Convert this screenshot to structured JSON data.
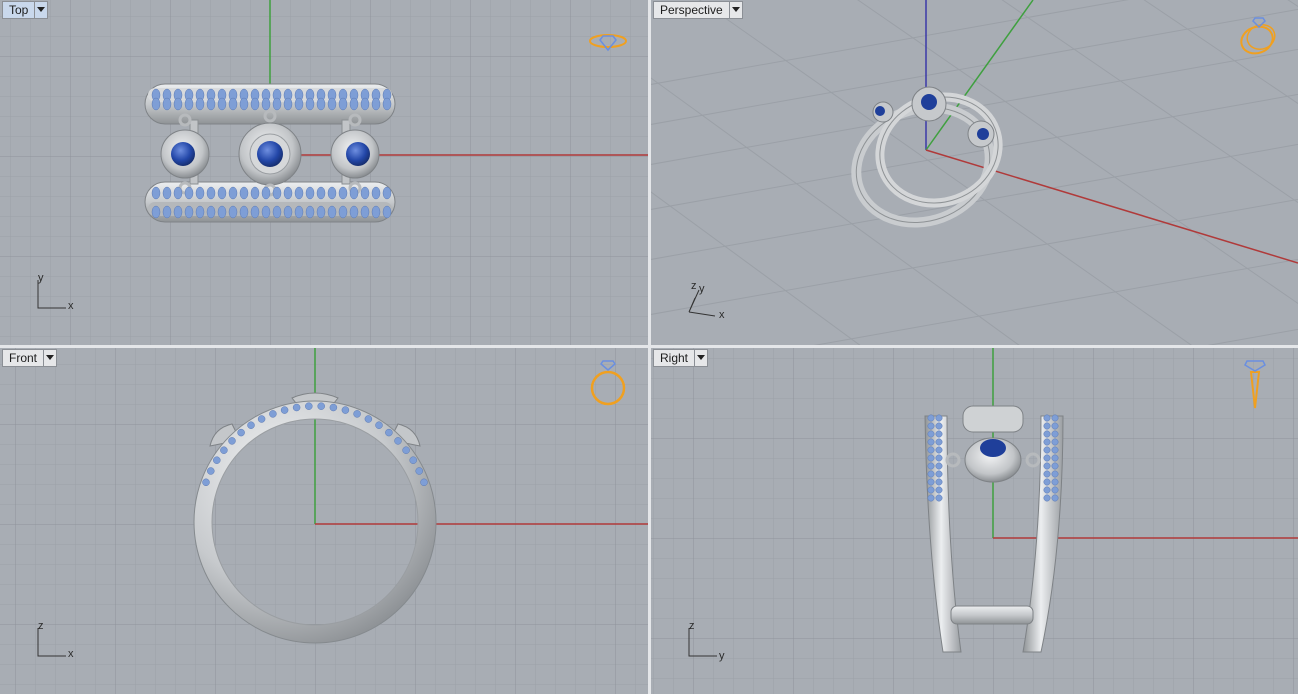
{
  "viewports": {
    "top": {
      "title": "Top",
      "axis_v": "y",
      "axis_h": "x"
    },
    "perspective": {
      "title": "Perspective",
      "axis_z": "z",
      "axis_y": "y",
      "axis_x": "x"
    },
    "front": {
      "title": "Front",
      "axis_v": "z",
      "axis_h": "x"
    },
    "right": {
      "title": "Right",
      "axis_v": "z",
      "axis_h": "y"
    }
  },
  "colors": {
    "background": "#a8adb4",
    "grid_minor": "#9ca1a8",
    "grid_major": "#8e939a",
    "x_axis": "#b03a3a",
    "y_axis": "#3fa03f",
    "z_axis": "#3a3aa8",
    "metal": "#c9cccf",
    "gem": "#7e9ed6",
    "center_gem": "#1f3f9a",
    "icon_orange": "#f0a020"
  },
  "icons": {
    "top_corner": "ring-top-view-icon",
    "persp_corner": "ring-perspective-icon",
    "front_corner": "ring-front-icon",
    "right_corner": "ring-side-icon"
  }
}
